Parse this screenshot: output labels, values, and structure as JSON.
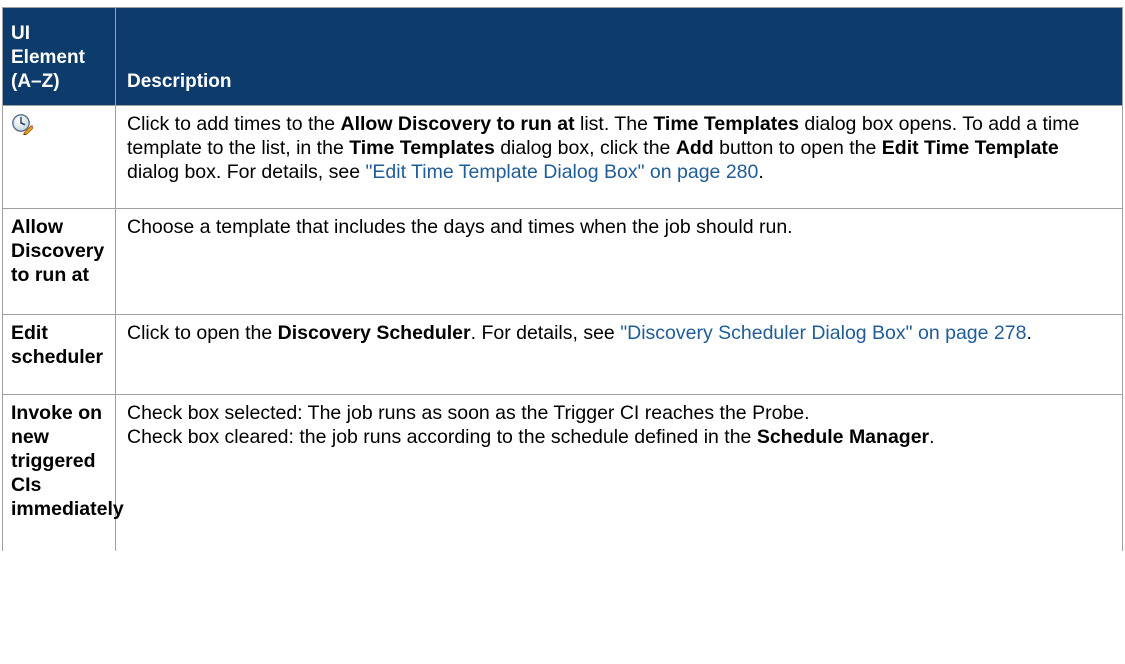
{
  "table": {
    "header": {
      "col1": "UI Element (A–Z)",
      "col2": "Description"
    },
    "rows": [
      {
        "element_icon": "clock-add-icon",
        "desc": {
          "p1": "Click to add times to the ",
          "b1": "Allow Discovery to run at",
          "p2": " list. The ",
          "b2": "Time Templates",
          "p3": " dialog box opens. To add a time template to the list, in the ",
          "b3": "Time Templates",
          "p4": " dialog box, click the ",
          "b4": "Add",
          "p5": " button to open the ",
          "b5": "Edit Time Template",
          "p6": " dialog box. For details, see ",
          "link": "\"Edit Time Template Dialog Box\" on page 280",
          "p7": "."
        }
      },
      {
        "element": "Allow Discovery to run at",
        "desc": {
          "p1": "Choose a template that includes the days and times when the job should run."
        }
      },
      {
        "element": "Edit scheduler",
        "desc": {
          "p1": "Click to open the ",
          "b1": "Discovery Scheduler",
          "p2": ". For details, see ",
          "link": "\"Discovery Scheduler Dialog Box\" on page 278",
          "p3": "."
        }
      },
      {
        "element": "Invoke on new triggered CIs immediately",
        "desc": {
          "line1": "Check box selected: The job runs as soon as the Trigger CI reaches the Probe.",
          "p2": "Check box cleared: the job runs according to the schedule defined in the ",
          "b2": "Schedule Manager",
          "p3": "."
        }
      }
    ]
  },
  "colors": {
    "header_bg": "#0c3b6c",
    "header_text": "#ffffff",
    "link": "#1f5c99",
    "border": "#a0a0a0"
  }
}
